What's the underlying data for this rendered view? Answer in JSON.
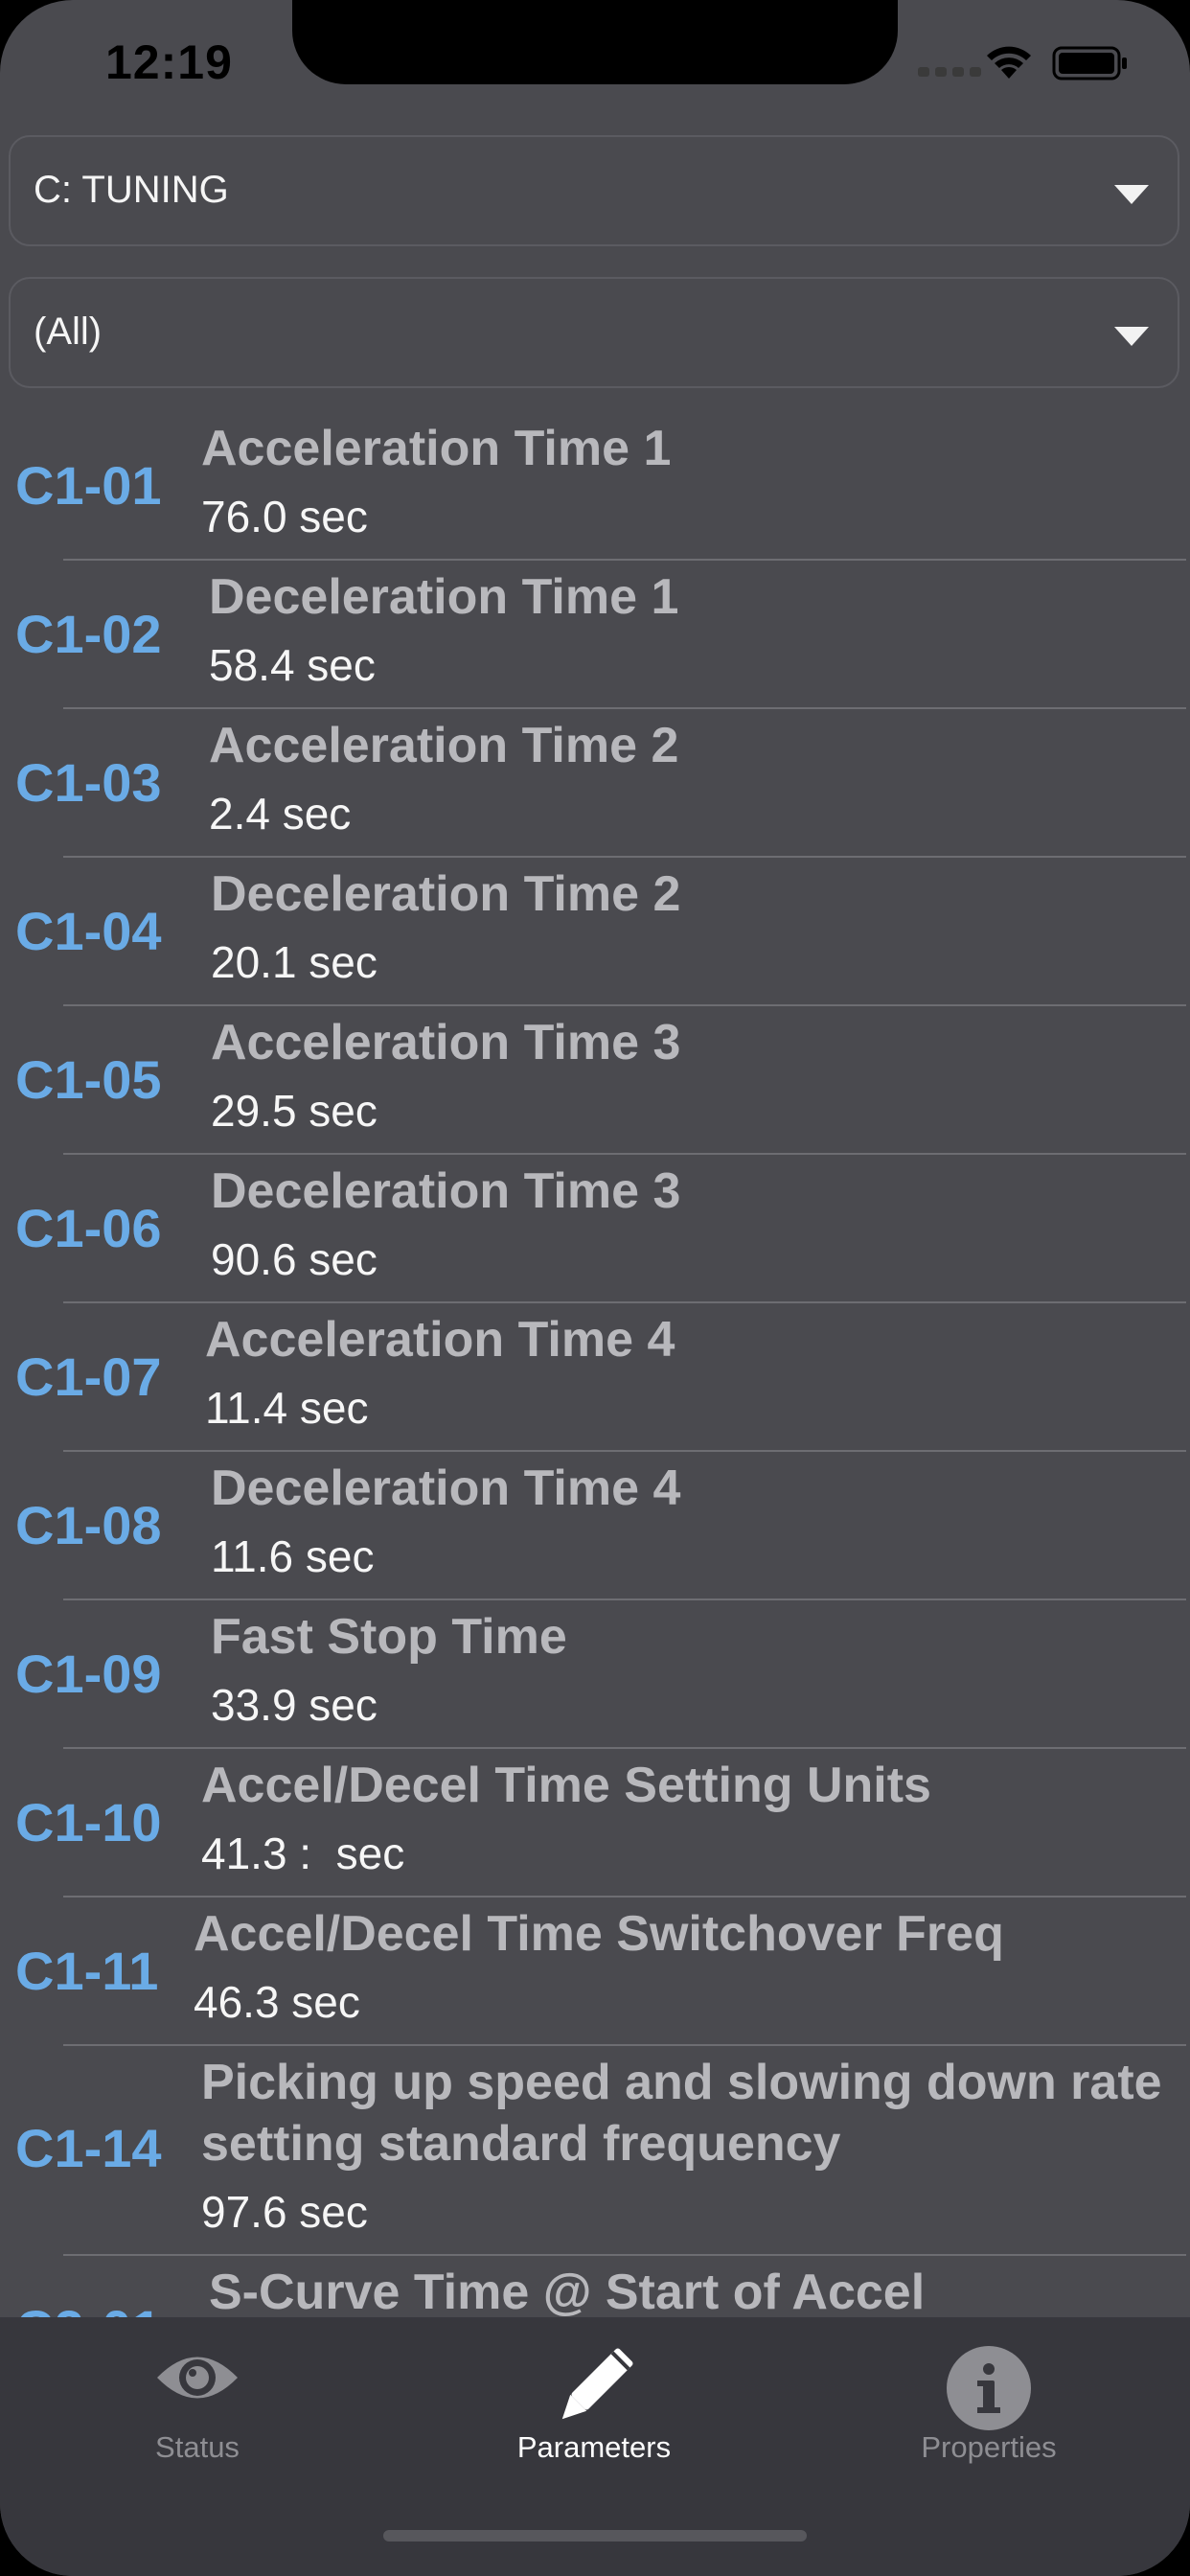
{
  "status_bar": {
    "time": "12:19"
  },
  "filters": {
    "group": "C: TUNING",
    "subgroup": "(All)"
  },
  "parameters": [
    {
      "code": "C1-01",
      "name": "Acceleration Time 1",
      "value": "76.0 sec"
    },
    {
      "code": "C1-02",
      "name": "Deceleration Time 1",
      "value": "58.4 sec"
    },
    {
      "code": "C1-03",
      "name": "Acceleration Time 2",
      "value": "2.4 sec"
    },
    {
      "code": "C1-04",
      "name": "Deceleration Time 2",
      "value": "20.1 sec"
    },
    {
      "code": "C1-05",
      "name": "Acceleration Time 3",
      "value": "29.5 sec"
    },
    {
      "code": "C1-06",
      "name": "Deceleration Time 3",
      "value": "90.6 sec"
    },
    {
      "code": "C1-07",
      "name": "Acceleration Time 4",
      "value": "11.4 sec"
    },
    {
      "code": "C1-08",
      "name": "Deceleration Time 4",
      "value": "11.6 sec"
    },
    {
      "code": "C1-09",
      "name": "Fast Stop Time",
      "value": "33.9 sec"
    },
    {
      "code": "C1-10",
      "name": "Accel/Decel Time Setting Units",
      "value": "41.3 :  sec"
    },
    {
      "code": "C1-11",
      "name": "Accel/Decel Time Switchover Freq",
      "value": "46.3 sec"
    },
    {
      "code": "C1-14",
      "name": "Picking up speed and slowing down rate",
      "name_line2": "setting standard frequency",
      "value": "97.6 sec"
    },
    {
      "code": "C2-01",
      "name": "S-Curve Time @ Start of Accel",
      "value": ""
    }
  ],
  "tabs": [
    {
      "label": "Status",
      "icon": "eye-icon",
      "active": false
    },
    {
      "label": "Parameters",
      "icon": "pencil-icon",
      "active": true
    },
    {
      "label": "Properties",
      "icon": "info-icon",
      "active": false
    }
  ],
  "colors": {
    "background": "#4a4a4f",
    "code": "#6aabe6",
    "name": "#b8b8bc",
    "value": "#f6f6f6",
    "tabbar": "#37373d",
    "tab_active": "#ffffff",
    "tab_inactive": "#8e8e93"
  }
}
